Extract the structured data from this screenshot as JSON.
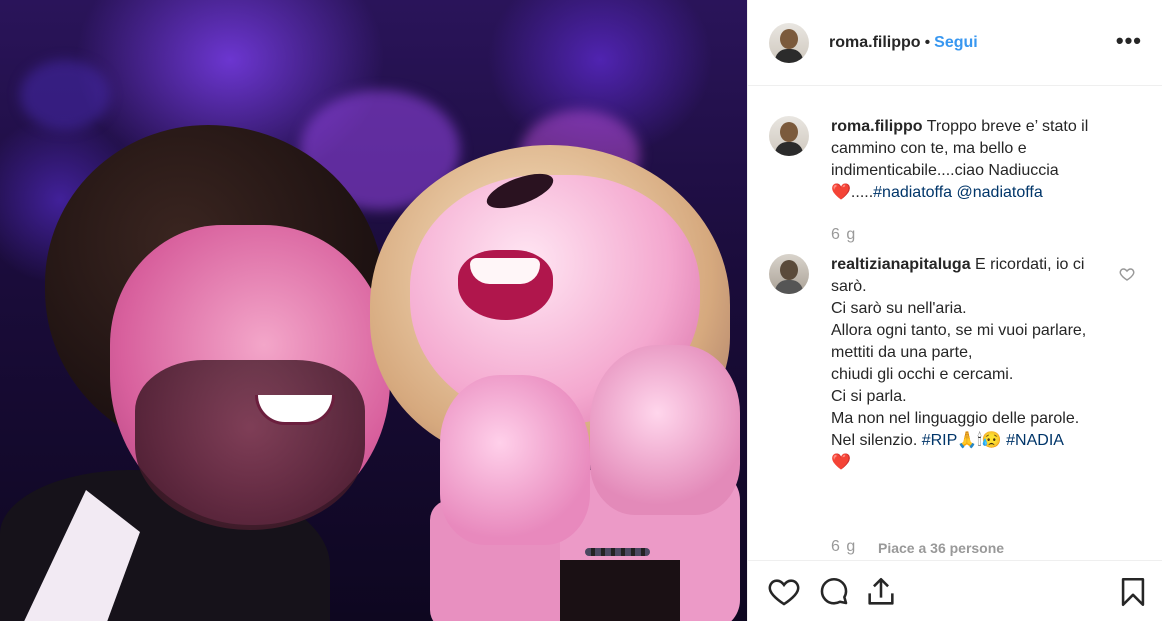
{
  "post": {
    "username": "roma.filippo",
    "separator": "•",
    "follow_label": "Segui",
    "more_label": "•••"
  },
  "comments": [
    {
      "username": "roma.filippo",
      "text": "Troppo breve e’ stato il cammino con te, ma bello e indimenticabile....ciao Nadiuccia",
      "emoji_heart": "❤️",
      "after_heart": ".....",
      "hashtag": "#nadiatoffa",
      "mention": "@nadiatoffa",
      "time": "6 g"
    },
    {
      "username": "realtizianapitaluga",
      "lines": [
        "E ricordati, io ci sarò.",
        "Ci sarò su nell'aria.",
        "Allora ogni tanto, se mi vuoi parlare,",
        "mettiti da una parte,",
        "chiudi gli occhi e cercami.",
        "Ci si parla.",
        "Ma non nel linguaggio delle parole.",
        "Nel silenzio."
      ],
      "hashtag_rip": "#RIP",
      "emojis": "🙏🕯😥",
      "hashtag_nadia": "#NADIA",
      "emoji_heart": "❤️",
      "time": "6 g",
      "likes": "Piace a 36 persone"
    }
  ],
  "icons": {
    "like": "heart-outline-icon",
    "comment": "speech-bubble-icon",
    "share": "share-upload-icon",
    "save": "bookmark-icon"
  },
  "colors": {
    "link": "#003569",
    "follow": "#3897f0",
    "muted": "#999999",
    "heart": "#d8152e"
  }
}
